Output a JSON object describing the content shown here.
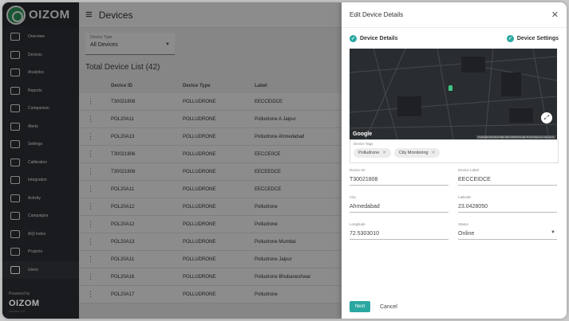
{
  "app": {
    "logo": "OIZOM",
    "page_title": "Devices"
  },
  "sidebar": {
    "items": [
      {
        "label": "Overview",
        "active": false
      },
      {
        "label": "Devices",
        "active": false
      },
      {
        "label": "Analytics",
        "active": false
      },
      {
        "label": "Reports",
        "active": false
      },
      {
        "label": "Comparison",
        "active": false
      },
      {
        "label": "Alerts",
        "active": false
      },
      {
        "label": "Settings",
        "active": false
      },
      {
        "label": "Calibration",
        "active": false
      },
      {
        "label": "Integration",
        "active": false
      },
      {
        "label": "Activity",
        "active": false
      },
      {
        "label": "Campaigns",
        "active": false
      },
      {
        "label": "AQI Index",
        "active": false
      },
      {
        "label": "Projects",
        "active": false
      },
      {
        "label": "Users",
        "active": true
      }
    ],
    "footer": {
      "powered": "Powered by",
      "logo": "OIZOM",
      "sub": "Version 4.0"
    }
  },
  "main": {
    "filter": {
      "label": "Device Type",
      "value": "All Devices"
    },
    "total_label": "Total Device List (42)",
    "columns": [
      "Device ID",
      "Device Type",
      "Label"
    ],
    "rows": [
      [
        "T30021808",
        "POLLUDRONE",
        "EECCEIDCE"
      ],
      [
        "POL20A11",
        "POLLUDRONE",
        "Polludrone A Jaipur"
      ],
      [
        "POL20A13",
        "POLLUDRONE",
        "Polludrone Ahmedabad"
      ],
      [
        "T30021806",
        "POLLUDRONE",
        "EECCE0CE"
      ],
      [
        "T30021808",
        "POLLUDRONE",
        "EECEEDCE"
      ],
      [
        "POL20A11",
        "POLLUDRONE",
        "EECCEDCE"
      ],
      [
        "POL20A12",
        "POLLUDRONE",
        "Polludrone"
      ],
      [
        "POL20A12",
        "POLLUDRONE",
        "Polludrone"
      ],
      [
        "POL20A13",
        "POLLUDRONE",
        "Polludrone Mumbai"
      ],
      [
        "POL20A11",
        "POLLUDRONE",
        "Polludrone Jaipur"
      ],
      [
        "POL20A16",
        "POLLUDRONE",
        "Polludrone Bhubaneshwar"
      ],
      [
        "POL20A17",
        "POLLUDRONE",
        "Polludrone"
      ]
    ]
  },
  "drawer": {
    "title": "Edit Device Details",
    "step1": "Device Details",
    "step2": "Device Settings",
    "map": {
      "brand": "Google",
      "attribution": "Keyboard shortcuts  Map data ©2023 Google  Terms  Report a map error"
    },
    "tags": {
      "label": "Device Tags",
      "items": [
        "Polludrone",
        "City Monitoring"
      ]
    },
    "fields": [
      {
        "label": "Device ID",
        "value": "T30021808"
      },
      {
        "label": "Device Label",
        "value": "EECCEIDCE"
      },
      {
        "label": "City",
        "value": "Ahmedabad"
      },
      {
        "label": "Latitude",
        "value": "23.0428050"
      },
      {
        "label": "Longitude",
        "value": "72.5303010"
      },
      {
        "label": "Status",
        "value": "Online"
      }
    ],
    "next_label": "Next",
    "cancel_label": "Cancel"
  }
}
